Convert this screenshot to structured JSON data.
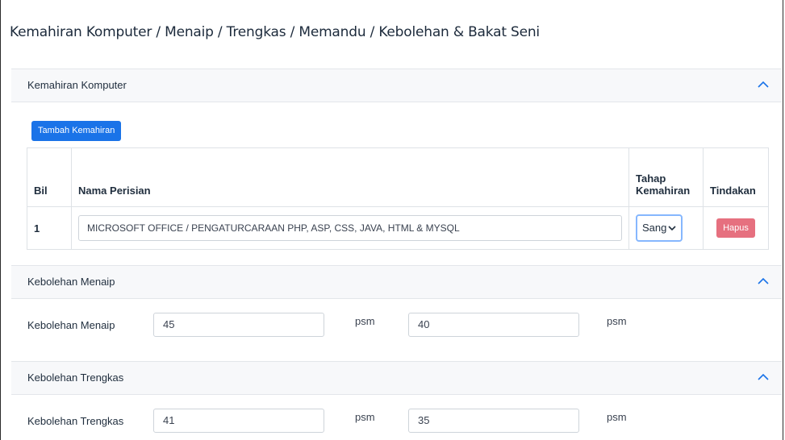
{
  "page": {
    "title": "Kemahiran Komputer / Menaip / Trengkas / Memandu / Kebolehan & Bakat Seni"
  },
  "komputer": {
    "header": "Kemahiran Komputer",
    "add_button": "Tambah Kemahiran",
    "columns": {
      "bil": "Bil",
      "nama": "Nama Perisian",
      "tahap": "Tahap Kemahiran",
      "tindakan": "Tindakan"
    },
    "rows": [
      {
        "bil": "1",
        "nama": "MICROSOFT OFFICE / PENGATURCARAAN PHP, ASP, CSS, JAVA, HTML & MYSQL",
        "tahap": "Sang",
        "action": "Hapus"
      }
    ]
  },
  "menaip": {
    "header": "Kebolehan Menaip",
    "label": "Kebolehan Menaip",
    "value1": "45",
    "unit1": "psm",
    "value2": "40",
    "unit2": "psm"
  },
  "trengkas": {
    "header": "Kebolehan Trengkas",
    "label": "Kebolehan Trengkas",
    "value1": "41",
    "unit1": "psm",
    "value2": "35",
    "unit2": "psm"
  },
  "colors": {
    "primary": "#1a73e8",
    "danger": "#e6707f",
    "header_bg": "#f7f8fa"
  }
}
